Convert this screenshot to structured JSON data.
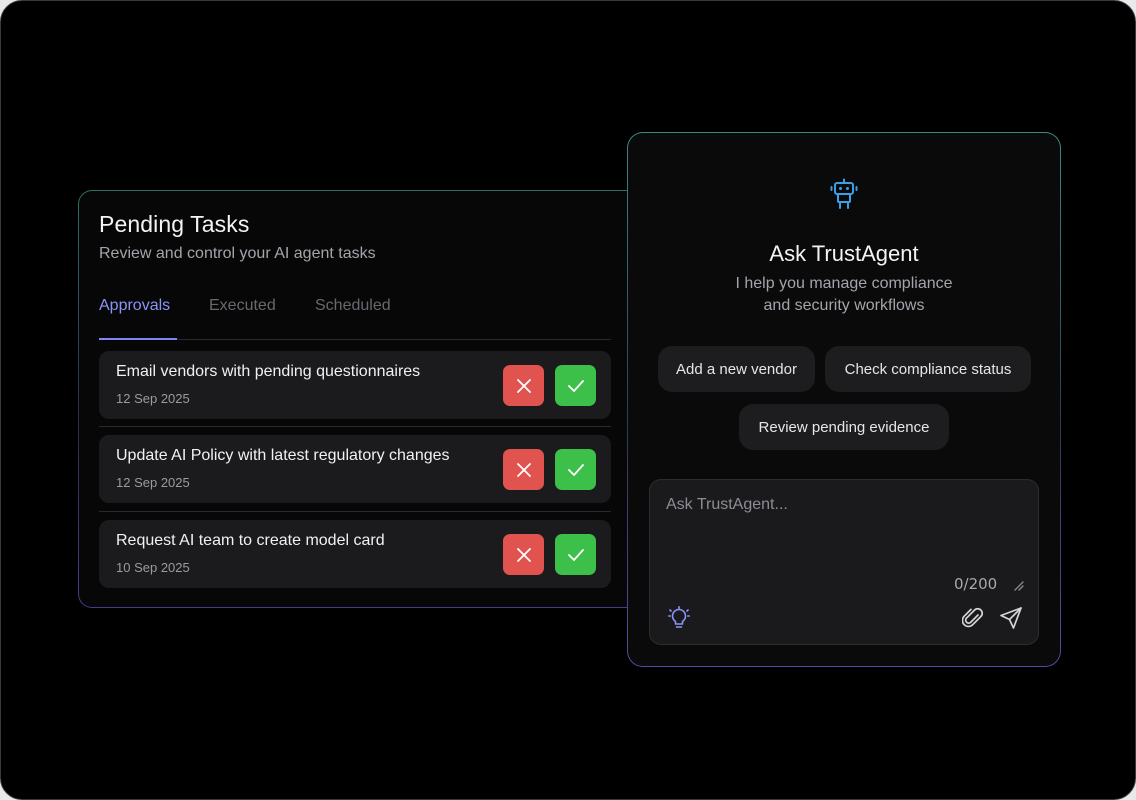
{
  "tasks": {
    "title": "Pending Tasks",
    "subtitle": "Review and control your AI agent tasks",
    "tabs": [
      {
        "label": "Approvals",
        "active": true
      },
      {
        "label": "Executed",
        "active": false
      },
      {
        "label": "Scheduled",
        "active": false
      }
    ],
    "items": [
      {
        "title": "Email vendors with pending questionnaires",
        "date": "12 Sep 2025"
      },
      {
        "title": "Update AI Policy with latest regulatory changes",
        "date": "12 Sep 2025"
      },
      {
        "title": "Request AI team to create model card",
        "date": "10 Sep 2025"
      }
    ]
  },
  "agent": {
    "icon": "robot-icon",
    "title": "Ask TrustAgent",
    "description_line1": "I help you manage compliance",
    "description_line2": "and security workflows",
    "suggestions": [
      {
        "label": "Add a new vendor"
      },
      {
        "label": "Check compliance status"
      },
      {
        "label": "Review pending evidence"
      }
    ],
    "input": {
      "value": "",
      "placeholder": "Ask TrustAgent...",
      "counter": "0/200"
    }
  },
  "colors": {
    "accent": "#8c93f6",
    "reject": "#e0534f",
    "approve": "#3cc04a",
    "robot": "#3b9ee8"
  }
}
